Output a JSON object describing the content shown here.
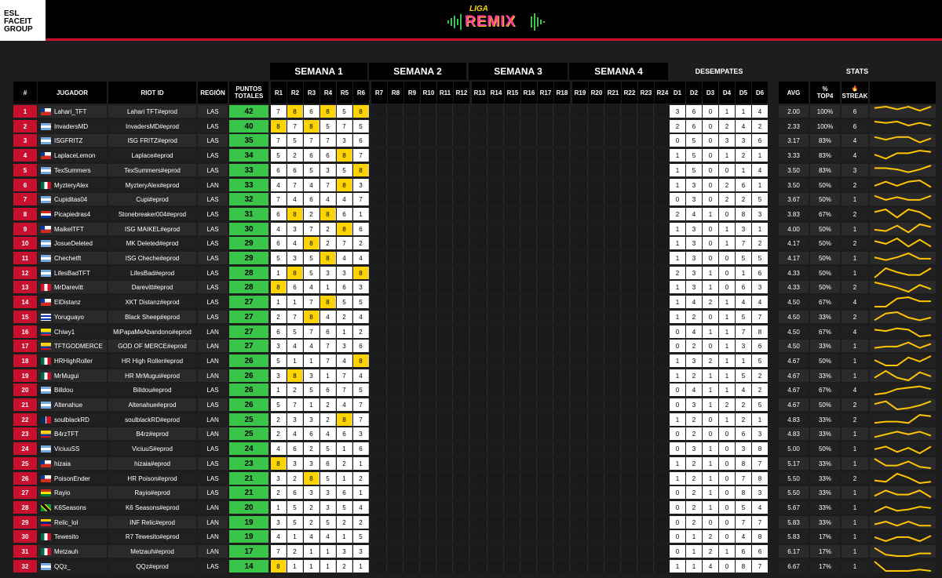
{
  "brand": {
    "esl_lines": [
      "ESL",
      "FACEIT",
      "GROUP"
    ],
    "logo_top": "LIGA",
    "logo_main": "REMIX"
  },
  "sections": {
    "week1": "SEMANA 1",
    "week2": "SEMANA 2",
    "week3": "SEMANA 3",
    "week4": "SEMANA 4",
    "tiebreak": "DESEMPATES",
    "stats": "STATS"
  },
  "columns": {
    "rank": "#",
    "player": "JUGADOR",
    "riot_id": "RIOT ID",
    "region": "REGIÓN",
    "total_line1": "PUNTOS",
    "total_line2": "TOTALES",
    "rounds": [
      "R1",
      "R2",
      "R3",
      "R4",
      "R5",
      "R6",
      "R7",
      "R8",
      "R9",
      "R10",
      "R11",
      "R12",
      "R13",
      "R14",
      "R15",
      "R16",
      "R17",
      "R18",
      "R19",
      "R20",
      "R21",
      "R22",
      "R23",
      "R24"
    ],
    "tiebreaks": [
      "D1",
      "D2",
      "D3",
      "D4",
      "D5",
      "D6"
    ],
    "avg": "AVG",
    "top4_line1": "%",
    "top4_line2": "TOP4",
    "streak": "STREAK"
  },
  "accent_colors": {
    "rank": "#c8102e",
    "points": "#3ac54a",
    "highlight_round": "#ffd400",
    "sparkline": "#ffc400"
  },
  "rows": [
    {
      "rank": "1",
      "flag": "cl",
      "player": "Lahari_TFT",
      "riot": "Lahari TFT#eprod",
      "region": "LAS",
      "total": "42",
      "r": [
        "7",
        "8",
        "6",
        "8",
        "5",
        "8"
      ],
      "d": [
        "3",
        "6",
        "0",
        "1",
        "1",
        "4"
      ],
      "avg": "2.00",
      "top4": "100%",
      "streak": "6"
    },
    {
      "rank": "2",
      "flag": "ar",
      "player": "InvadersMD",
      "riot": "InvadersMD#eprod",
      "region": "LAS",
      "total": "40",
      "r": [
        "8",
        "7",
        "8",
        "5",
        "7",
        "5"
      ],
      "d": [
        "2",
        "6",
        "0",
        "2",
        "4",
        "2"
      ],
      "avg": "2.33",
      "top4": "100%",
      "streak": "6"
    },
    {
      "rank": "3",
      "flag": "ar",
      "player": "ISGFRITZ",
      "riot": "ISG FRITZ#eprod",
      "region": "LAS",
      "total": "35",
      "r": [
        "7",
        "5",
        "7",
        "7",
        "3",
        "6"
      ],
      "d": [
        "0",
        "5",
        "0",
        "3",
        "3",
        "6"
      ],
      "avg": "3.17",
      "top4": "83%",
      "streak": "4"
    },
    {
      "rank": "4",
      "flag": "cl",
      "player": "LaplaceLemon",
      "riot": "Laplace#eprod",
      "region": "LAS",
      "total": "34",
      "r": [
        "5",
        "2",
        "6",
        "6",
        "8",
        "7"
      ],
      "d": [
        "1",
        "5",
        "0",
        "1",
        "2",
        "1"
      ],
      "avg": "3.33",
      "top4": "83%",
      "streak": "4"
    },
    {
      "rank": "5",
      "flag": "ar",
      "player": "TexSummers",
      "riot": "TexSummers#eprod",
      "region": "LAS",
      "total": "33",
      "r": [
        "6",
        "6",
        "5",
        "3",
        "5",
        "8"
      ],
      "d": [
        "1",
        "5",
        "0",
        "0",
        "1",
        "4"
      ],
      "avg": "3.50",
      "top4": "83%",
      "streak": "3"
    },
    {
      "rank": "6",
      "flag": "mx",
      "player": "MyzteryAlex",
      "riot": "MyzteryAlex#eprod",
      "region": "LAN",
      "total": "33",
      "r": [
        "4",
        "7",
        "4",
        "7",
        "8",
        "3"
      ],
      "d": [
        "1",
        "3",
        "0",
        "2",
        "6",
        "1"
      ],
      "avg": "3.50",
      "top4": "50%",
      "streak": "2"
    },
    {
      "rank": "7",
      "flag": "ar",
      "player": "Cupiditas04",
      "riot": "Cupi#eprod",
      "region": "LAS",
      "total": "32",
      "r": [
        "7",
        "4",
        "6",
        "4",
        "4",
        "7"
      ],
      "d": [
        "0",
        "3",
        "0",
        "2",
        "2",
        "5"
      ],
      "avg": "3.67",
      "top4": "50%",
      "streak": "1"
    },
    {
      "rank": "8",
      "flag": "py",
      "player": "Picapiedras4",
      "riot": "Stonebreaker004#eprod",
      "region": "LAS",
      "total": "31",
      "r": [
        "6",
        "8",
        "2",
        "8",
        "6",
        "1"
      ],
      "d": [
        "2",
        "4",
        "1",
        "0",
        "8",
        "3"
      ],
      "avg": "3.83",
      "top4": "67%",
      "streak": "2"
    },
    {
      "rank": "9",
      "flag": "cl",
      "player": "MaikelTFT",
      "riot": "ISG MAIKEL#eprod",
      "region": "LAS",
      "total": "30",
      "r": [
        "4",
        "3",
        "7",
        "2",
        "8",
        "6"
      ],
      "d": [
        "1",
        "3",
        "0",
        "1",
        "3",
        "1"
      ],
      "avg": "4.00",
      "top4": "50%",
      "streak": "1"
    },
    {
      "rank": "10",
      "flag": "ar",
      "player": "JosueDeleted",
      "riot": "MK Deleted#eprod",
      "region": "LAS",
      "total": "29",
      "r": [
        "6",
        "4",
        "8",
        "2",
        "7",
        "2"
      ],
      "d": [
        "1",
        "3",
        "0",
        "1",
        "7",
        "2"
      ],
      "avg": "4.17",
      "top4": "50%",
      "streak": "2"
    },
    {
      "rank": "11",
      "flag": "ar",
      "player": "Chechetft",
      "riot": "ISG Cheche#eprod",
      "region": "LAS",
      "total": "29",
      "r": [
        "5",
        "3",
        "5",
        "8",
        "4",
        "4"
      ],
      "d": [
        "1",
        "3",
        "0",
        "0",
        "5",
        "5"
      ],
      "avg": "4.17",
      "top4": "50%",
      "streak": "1"
    },
    {
      "rank": "12",
      "flag": "ar",
      "player": "LifesBadTFT",
      "riot": "LifesBad#eprod",
      "region": "LAS",
      "total": "28",
      "r": [
        "1",
        "8",
        "5",
        "3",
        "3",
        "8"
      ],
      "d": [
        "2",
        "3",
        "1",
        "0",
        "1",
        "6"
      ],
      "avg": "4.33",
      "top4": "50%",
      "streak": "1"
    },
    {
      "rank": "13",
      "flag": "pe",
      "player": "MrDarevitt",
      "riot": "Darevitt#eprod",
      "region": "LAS",
      "total": "28",
      "r": [
        "8",
        "6",
        "4",
        "1",
        "6",
        "3"
      ],
      "d": [
        "1",
        "3",
        "1",
        "0",
        "6",
        "3"
      ],
      "avg": "4.33",
      "top4": "50%",
      "streak": "2"
    },
    {
      "rank": "14",
      "flag": "cl",
      "player": "ElDistanz",
      "riot": "XKT Distanz#eprod",
      "region": "LAS",
      "total": "27",
      "r": [
        "1",
        "1",
        "7",
        "8",
        "5",
        "5"
      ],
      "d": [
        "1",
        "4",
        "2",
        "1",
        "4",
        "4"
      ],
      "avg": "4.50",
      "top4": "67%",
      "streak": "4"
    },
    {
      "rank": "15",
      "flag": "uy",
      "player": "Yoruguayo",
      "riot": "Black Sheep#eprod",
      "region": "LAS",
      "total": "27",
      "r": [
        "2",
        "7",
        "8",
        "4",
        "2",
        "4"
      ],
      "d": [
        "1",
        "2",
        "0",
        "1",
        "5",
        "7"
      ],
      "avg": "4.50",
      "top4": "33%",
      "streak": "2"
    },
    {
      "rank": "16",
      "flag": "ec",
      "player": "Chiwy1",
      "riot": "MiPapaMeAbandono#eprod",
      "region": "LAN",
      "total": "27",
      "r": [
        "6",
        "5",
        "7",
        "6",
        "1",
        "2"
      ],
      "d": [
        "0",
        "4",
        "1",
        "1",
        "7",
        "8"
      ],
      "avg": "4.50",
      "top4": "67%",
      "streak": "4"
    },
    {
      "rank": "17",
      "flag": "co",
      "player": "TFTGODMERCE",
      "riot": "GOD OF MERCE#eprod",
      "region": "LAN",
      "total": "27",
      "r": [
        "3",
        "4",
        "4",
        "7",
        "3",
        "6"
      ],
      "d": [
        "0",
        "2",
        "0",
        "1",
        "3",
        "6"
      ],
      "avg": "4.50",
      "top4": "33%",
      "streak": "1"
    },
    {
      "rank": "18",
      "flag": "mx",
      "player": "HRHighRoller",
      "riot": "HR High Roller#eprod",
      "region": "LAN",
      "total": "26",
      "r": [
        "5",
        "1",
        "1",
        "7",
        "4",
        "8"
      ],
      "d": [
        "1",
        "3",
        "2",
        "1",
        "1",
        "5"
      ],
      "avg": "4.67",
      "top4": "50%",
      "streak": "1"
    },
    {
      "rank": "19",
      "flag": "mx",
      "player": "MrMugui",
      "riot": "HR MrMugui#eprod",
      "region": "LAN",
      "total": "26",
      "r": [
        "3",
        "8",
        "3",
        "1",
        "7",
        "4"
      ],
      "d": [
        "1",
        "2",
        "1",
        "1",
        "5",
        "2"
      ],
      "avg": "4.67",
      "top4": "33%",
      "streak": "1"
    },
    {
      "rank": "20",
      "flag": "ar",
      "player": "Billdou",
      "riot": "Billdou#eprod",
      "region": "LAS",
      "total": "26",
      "r": [
        "1",
        "2",
        "5",
        "6",
        "7",
        "5"
      ],
      "d": [
        "0",
        "4",
        "1",
        "1",
        "4",
        "2"
      ],
      "avg": "4.67",
      "top4": "67%",
      "streak": "4"
    },
    {
      "rank": "21",
      "flag": "ar",
      "player": "Altenahue",
      "riot": "Altenahue#eprod",
      "region": "LAS",
      "total": "26",
      "r": [
        "5",
        "7",
        "1",
        "2",
        "4",
        "7"
      ],
      "d": [
        "0",
        "3",
        "1",
        "2",
        "2",
        "5"
      ],
      "avg": "4.67",
      "top4": "50%",
      "streak": "2"
    },
    {
      "rank": "22",
      "flag": "do",
      "player": "soulblackRD",
      "riot": "soulblackRD#eprod",
      "region": "LAN",
      "total": "25",
      "r": [
        "2",
        "3",
        "3",
        "2",
        "8",
        "7"
      ],
      "d": [
        "1",
        "2",
        "0",
        "1",
        "2",
        "1"
      ],
      "avg": "4.83",
      "top4": "33%",
      "streak": "2"
    },
    {
      "rank": "23",
      "flag": "co",
      "player": "B4rzTFT",
      "riot": "B4rz#eprod",
      "region": "LAN",
      "total": "25",
      "r": [
        "2",
        "4",
        "6",
        "4",
        "6",
        "3"
      ],
      "d": [
        "0",
        "2",
        "0",
        "0",
        "6",
        "3"
      ],
      "avg": "4.83",
      "top4": "33%",
      "streak": "1"
    },
    {
      "rank": "24",
      "flag": "ar",
      "player": "ViciuuSS",
      "riot": "ViciuuS#eprod",
      "region": "LAS",
      "total": "24",
      "r": [
        "4",
        "6",
        "2",
        "5",
        "1",
        "6"
      ],
      "d": [
        "0",
        "3",
        "1",
        "0",
        "3",
        "8"
      ],
      "avg": "5.00",
      "top4": "50%",
      "streak": "1"
    },
    {
      "rank": "25",
      "flag": "cl",
      "player": "hizaia",
      "riot": "hizaia#eprod",
      "region": "LAS",
      "total": "23",
      "r": [
        "8",
        "3",
        "3",
        "6",
        "2",
        "1"
      ],
      "d": [
        "1",
        "2",
        "1",
        "0",
        "8",
        "7"
      ],
      "avg": "5.17",
      "top4": "33%",
      "streak": "1"
    },
    {
      "rank": "26",
      "flag": "cl",
      "player": "PoisonEnder",
      "riot": "HR Poison#eprod",
      "region": "LAS",
      "total": "21",
      "r": [
        "3",
        "2",
        "8",
        "5",
        "1",
        "2"
      ],
      "d": [
        "1",
        "2",
        "1",
        "0",
        "7",
        "8"
      ],
      "avg": "5.50",
      "top4": "33%",
      "streak": "2"
    },
    {
      "rank": "27",
      "flag": "bo",
      "player": "Rayio",
      "riot": "Rayio#eprod",
      "region": "LAS",
      "total": "21",
      "r": [
        "2",
        "6",
        "3",
        "3",
        "6",
        "1"
      ],
      "d": [
        "0",
        "2",
        "1",
        "0",
        "8",
        "3"
      ],
      "avg": "5.50",
      "top4": "33%",
      "streak": "1"
    },
    {
      "rank": "28",
      "flag": "jm",
      "player": "K6Seasons",
      "riot": "K6 Seasons#eprod",
      "region": "LAN",
      "total": "20",
      "r": [
        "1",
        "5",
        "2",
        "3",
        "5",
        "4"
      ],
      "d": [
        "0",
        "2",
        "1",
        "0",
        "5",
        "4"
      ],
      "avg": "5.67",
      "top4": "33%",
      "streak": "1"
    },
    {
      "rank": "29",
      "flag": "ve",
      "player": "Relic_lol",
      "riot": "INF Relic#eprod",
      "region": "LAN",
      "total": "19",
      "r": [
        "3",
        "5",
        "2",
        "5",
        "2",
        "2"
      ],
      "d": [
        "0",
        "2",
        "0",
        "0",
        "7",
        "7"
      ],
      "avg": "5.83",
      "top4": "33%",
      "streak": "1"
    },
    {
      "rank": "30",
      "flag": "mx",
      "player": "Tewesito",
      "riot": "R7 Tewesito#eprod",
      "region": "LAN",
      "total": "19",
      "r": [
        "4",
        "1",
        "4",
        "4",
        "1",
        "5"
      ],
      "d": [
        "0",
        "1",
        "2",
        "0",
        "4",
        "8"
      ],
      "avg": "5.83",
      "top4": "17%",
      "streak": "1"
    },
    {
      "rank": "31",
      "flag": "mx",
      "player": "Metzauh",
      "riot": "Metzauh#eprod",
      "region": "LAN",
      "total": "17",
      "r": [
        "7",
        "2",
        "1",
        "1",
        "3",
        "3"
      ],
      "d": [
        "0",
        "1",
        "2",
        "1",
        "6",
        "6"
      ],
      "avg": "6.17",
      "top4": "17%",
      "streak": "1"
    },
    {
      "rank": "32",
      "flag": "ar",
      "player": "QQz_",
      "riot": "QQz#eprod",
      "region": "LAS",
      "total": "14",
      "r": [
        "8",
        "1",
        "1",
        "1",
        "2",
        "1"
      ],
      "d": [
        "1",
        "1",
        "4",
        "0",
        "8",
        "7"
      ],
      "avg": "6.67",
      "top4": "17%",
      "streak": "1"
    }
  ]
}
